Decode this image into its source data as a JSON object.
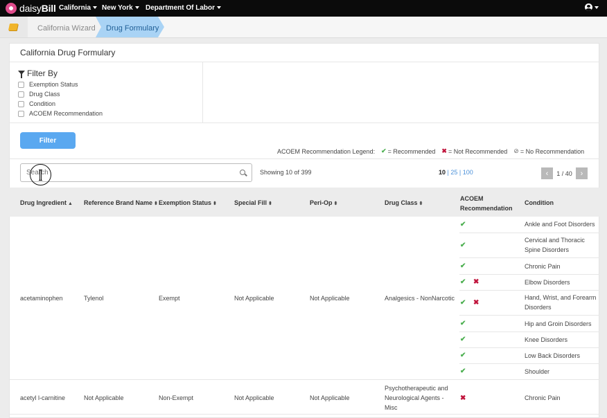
{
  "topnav": {
    "logo_prefix": "daisy",
    "logo_suffix": "Bill",
    "items": [
      {
        "label": "California"
      },
      {
        "label": "New York"
      },
      {
        "label": "Department Of Labor"
      }
    ]
  },
  "breadcrumb": {
    "items": [
      {
        "label": "California Wizard"
      },
      {
        "label": "Drug Formulary"
      }
    ]
  },
  "page": {
    "title": "California Drug Formulary"
  },
  "filter": {
    "heading": "Filter By",
    "options": [
      {
        "label": "Exemption Status",
        "checked": false
      },
      {
        "label": "Drug Class",
        "checked": false
      },
      {
        "label": "Condition",
        "checked": false
      },
      {
        "label": "ACOEM Recommendation",
        "checked": false
      }
    ],
    "button_label": "Filter"
  },
  "legend": {
    "title": "ACOEM Recommendation Legend:",
    "recommended": "= Recommended",
    "not_recommended": "= Not Recommended",
    "no_recommendation": "= No Recommendation"
  },
  "search": {
    "placeholder": "Search",
    "value": ""
  },
  "results": {
    "showing": "Showing 10 of 399",
    "page_sizes": [
      "10",
      "25",
      "100"
    ],
    "selected_page_size": "10",
    "page_label": "1 / 40",
    "prev": "‹",
    "next": "›"
  },
  "table": {
    "headers": {
      "drug_ingredient": "Drug Ingredient",
      "brand": "Reference Brand Name",
      "exemption": "Exemption Status",
      "special_fill": "Special Fill",
      "peri_op": "Peri-Op",
      "drug_class": "Drug Class",
      "acoem_line1": "ACOEM",
      "acoem_line2": "Recommendation",
      "condition": "Condition"
    },
    "rows": [
      {
        "drug_ingredient": "acetaminophen",
        "brand": "Tylenol",
        "exemption": "Exempt",
        "special_fill": "Not Applicable",
        "peri_op": "Not Applicable",
        "drug_class": "Analgesics - NonNarcotic",
        "conditions": [
          {
            "acoem": [
              "recommended"
            ],
            "condition": "Ankle and Foot Disorders"
          },
          {
            "acoem": [
              "recommended"
            ],
            "condition": "Cervical and Thoracic Spine Disorders"
          },
          {
            "acoem": [
              "recommended"
            ],
            "condition": "Chronic Pain"
          },
          {
            "acoem": [
              "recommended",
              "not-recommended"
            ],
            "condition": "Elbow Disorders"
          },
          {
            "acoem": [
              "recommended",
              "not-recommended"
            ],
            "condition": "Hand, Wrist, and Forearm Disorders"
          },
          {
            "acoem": [
              "recommended"
            ],
            "condition": "Hip and Groin Disorders"
          },
          {
            "acoem": [
              "recommended"
            ],
            "condition": "Knee Disorders"
          },
          {
            "acoem": [
              "recommended"
            ],
            "condition": "Low Back Disorders"
          },
          {
            "acoem": [
              "recommended"
            ],
            "condition": "Shoulder"
          }
        ]
      },
      {
        "drug_ingredient": "acetyl l-carnitine",
        "brand": "Not Applicable",
        "exemption": "Non-Exempt",
        "special_fill": "Not Applicable",
        "peri_op": "Not Applicable",
        "drug_class": "Psychotherapeutic and Neurological Agents - Misc",
        "conditions": [
          {
            "acoem": [
              "not-recommended"
            ],
            "condition": "Chronic Pain"
          }
        ]
      }
    ]
  },
  "symbols": {
    "check": "✔",
    "cross": "✖",
    "none": "⊘"
  },
  "colors": {
    "topnav_bg": "#0b0b0b",
    "accent_blue": "#5aa8f0",
    "active_crumb": "#a9d3f5",
    "recommended": "#4caf50",
    "not_recommended": "#c0143c"
  }
}
